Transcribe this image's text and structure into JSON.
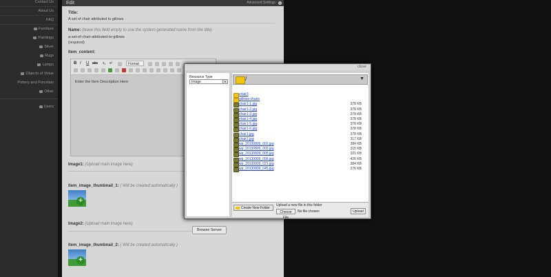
{
  "sidebar": {
    "items": [
      {
        "label": "Contact Us"
      },
      {
        "label": "About Us"
      },
      {
        "label": "FAQ"
      },
      {
        "label": "Furniture"
      },
      {
        "label": "Paintings"
      },
      {
        "label": "Silver"
      },
      {
        "label": "Rugs"
      },
      {
        "label": "Lamps"
      },
      {
        "label": "Objects of Virtue"
      },
      {
        "label": "Pottery and Porcelain"
      },
      {
        "label": "Other"
      },
      {
        "label": "Users"
      }
    ]
  },
  "panel": {
    "title": "Edit",
    "advanced": "Advanced Settings",
    "title_label": "Title:",
    "title_value": "A set of chair attributed to gillows",
    "name_label": "Name:",
    "name_hint": "(leave this field empty to use the system generated name from the title)",
    "name_value": "a-set-of-chair-attributed-to-gillows",
    "name_required": "(required)",
    "content_label": "item_content:",
    "toolbar_format": "Format",
    "editor_text": "Enter the Item Description Here",
    "image1_label": "Image1:",
    "image1_hint": "(Upload main image here)",
    "thumb1_label": "item_image_thumbnail_1:",
    "thumb1_hint": "( Will be created automatically )",
    "image2_label": "Image2:",
    "image2_hint": "(Upload main image here)",
    "browse_label": "Browse Server",
    "thumb2_label": "item_image_thumbnail_2:",
    "thumb2_hint": "( Will be created automatically )"
  },
  "dialog": {
    "close_label": "close",
    "resource_type_label": "Resource Type",
    "resource_type_value": "Image",
    "path": "/",
    "files": [
      {
        "name": "chair3",
        "size": "",
        "kind": "folder"
      },
      {
        "name": "gillows-chairs",
        "size": "",
        "kind": "folder"
      },
      {
        "name": "chair1-1.jpg",
        "size": "378 KB",
        "kind": "image"
      },
      {
        "name": "chair1-2.jpg",
        "size": "378 KB",
        "kind": "image"
      },
      {
        "name": "chair1-3.jpg",
        "size": "378 KB",
        "kind": "image"
      },
      {
        "name": "chair1-4.jpg",
        "size": "378 KB",
        "kind": "image"
      },
      {
        "name": "chair1-5.jpg",
        "size": "378 KB",
        "kind": "image"
      },
      {
        "name": "chair1-6.jpg",
        "size": "378 KB",
        "kind": "image"
      },
      {
        "name": "chair1.jpg",
        "size": "378 KB",
        "kind": "image"
      },
      {
        "name": "chair2.jpg",
        "size": "317 KB",
        "kind": "image"
      },
      {
        "name": "wp_20130809_002.jpg",
        "size": "384 KB",
        "kind": "image"
      },
      {
        "name": "wp_20130809_003.jpg",
        "size": "315 KB",
        "kind": "image"
      },
      {
        "name": "wp_20130809_005.jpg",
        "size": "321 KB",
        "kind": "image"
      },
      {
        "name": "wp_20130809_006.jpg",
        "size": "426 KB",
        "kind": "image"
      },
      {
        "name": "wp_20130809_021.jpg",
        "size": "384 KB",
        "kind": "image"
      },
      {
        "name": "wp_20130809_045.jpg",
        "size": "276 KB",
        "kind": "image"
      }
    ],
    "create_folder_label": "Create New Folder",
    "upload_label": "Upload a new file in this folder",
    "choose_file_label": "Choose File",
    "no_file_label": "No file chosen",
    "upload_button_label": "Upload"
  }
}
